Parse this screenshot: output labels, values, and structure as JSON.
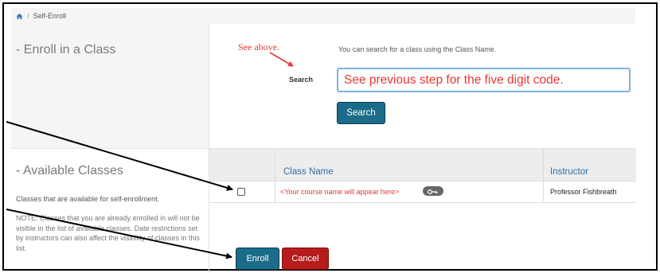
{
  "breadcrumb": {
    "home_icon": "home-icon",
    "separator": "/",
    "current": "Self-Enroll"
  },
  "enroll_section": {
    "title": "- Enroll in a Class"
  },
  "annotation_top": "See above.",
  "search": {
    "hint": "You can search for a class using the Class Name.",
    "label": "Search",
    "input_value": "See previous step for the five digit code.",
    "button_label": "Search"
  },
  "available_section": {
    "title": "- Available Classes",
    "description": "Classes that are available for self-enrollment.",
    "note": "NOTE: Classes that you are already enrolled in will not be visible in the list of available classes. Date restrictions set by instructors can also affect the visibility of classes in this list."
  },
  "table": {
    "headers": {
      "class_name": "Class Name",
      "instructor": "Instructor"
    },
    "rows": [
      {
        "class_name": "<Your course name will appear here>",
        "key_icon": "key-icon",
        "instructor": "Professor Fishbreath"
      }
    ]
  },
  "actions": {
    "enroll_label": "Enroll",
    "cancel_label": "Cancel"
  },
  "colors": {
    "accent_blue": "#1b6c88",
    "danger_red": "#b71c1c",
    "annotation_red": "#e53935",
    "link_blue": "#2e6fa8"
  }
}
